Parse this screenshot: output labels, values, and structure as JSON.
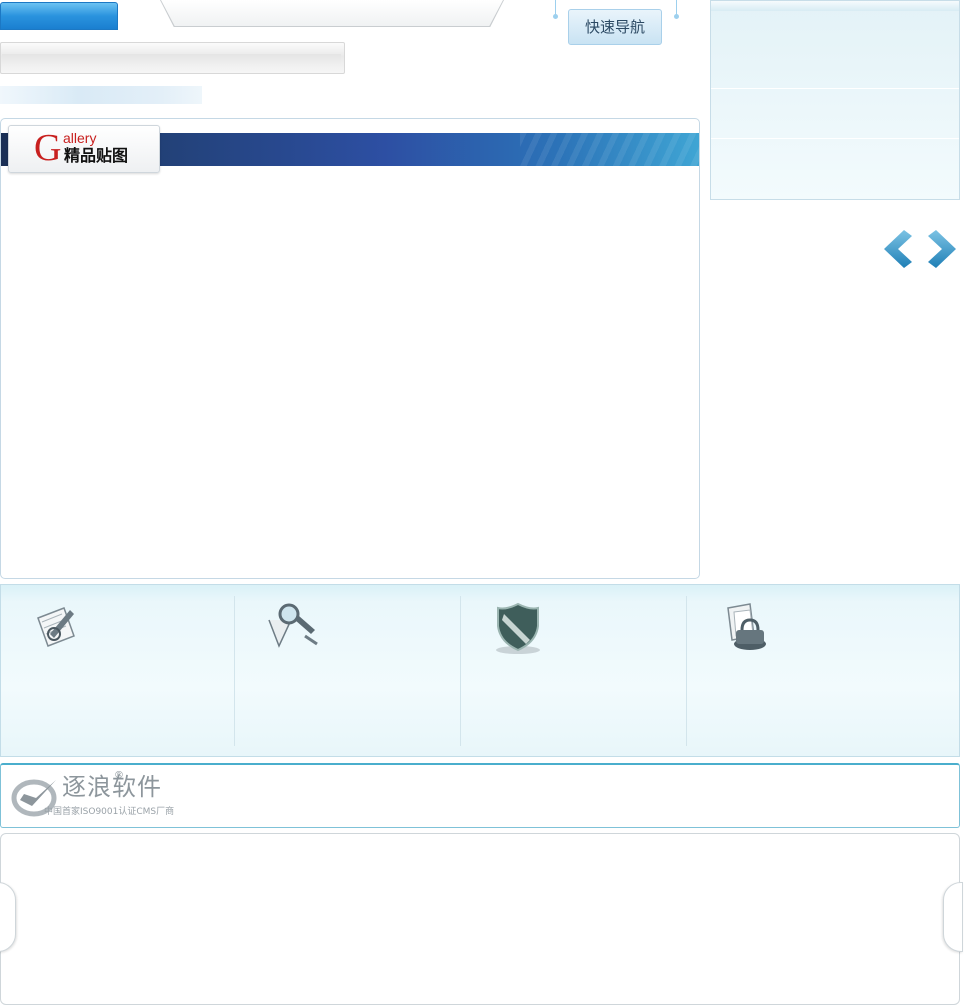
{
  "header": {
    "quick_nav_label": "快速导航"
  },
  "gallery": {
    "tab_initial": "G",
    "tab_english": "allery",
    "tab_chinese": "精品贴图"
  },
  "features": {
    "icons": [
      "document-pen-icon",
      "magnifier-icon",
      "shield-icon",
      "lock-document-icon"
    ]
  },
  "brand": {
    "name": "逐浪软件",
    "registered": "®",
    "tagline": "中国首家ISO9001认证CMS厂商"
  },
  "colors": {
    "accent_blue": "#2a93de",
    "banner_dark": "#1a2f55",
    "gallery_red": "#c8201f",
    "panel_light": "#e3f2f7"
  }
}
